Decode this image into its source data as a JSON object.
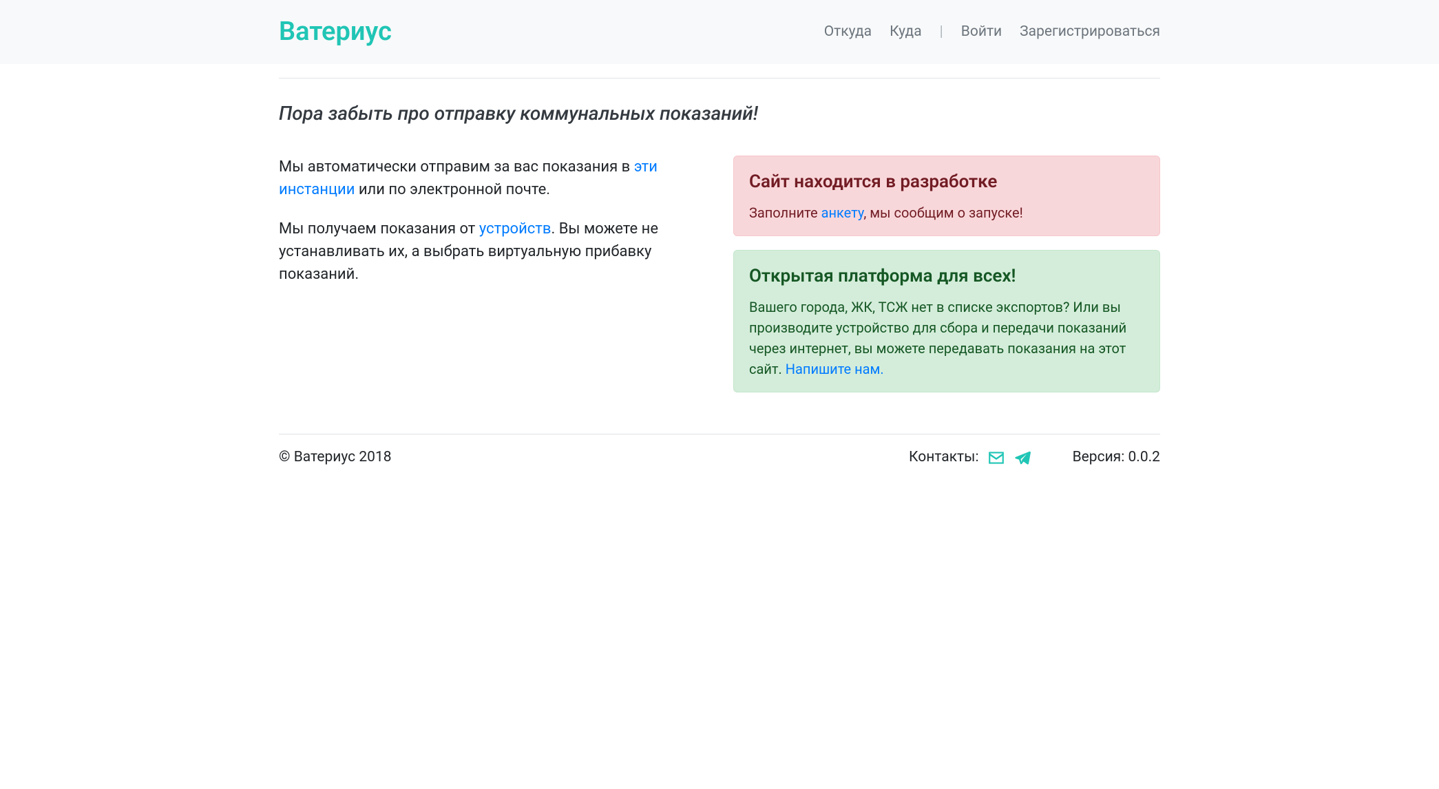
{
  "header": {
    "brand": "Ватериус",
    "nav": {
      "from": "Откуда",
      "to": "Куда",
      "login": "Войти",
      "register": "Зарегистрироваться"
    }
  },
  "main": {
    "slogan": "Пора забыть про отправку коммунальных показаний!",
    "para1_before": "Мы автоматически отправим за вас показания в ",
    "para1_link": "эти инстанции",
    "para1_after": " или по электронной почте.",
    "para2_before": "Мы получаем показания от ",
    "para2_link": "устройств",
    "para2_after": ". Вы можете не устанавливать их, а выбрать виртуальную прибавку показаний.",
    "alert_danger": {
      "heading": "Сайт находится в разработке",
      "text_before": "Заполните ",
      "link": "анкету",
      "text_after": ", мы сообщим о запуске!"
    },
    "alert_success": {
      "heading": "Открытая платформа для всех!",
      "text_before": "Вашего города, ЖК, ТСЖ нет в списке экспортов? Или вы производите устройство для сбора и передачи показаний через интернет, вы можете передавать показания на этот сайт. ",
      "link": "Напишите нам."
    }
  },
  "footer": {
    "copyright": "© Ватериус 2018",
    "contacts_label": "Контакты:",
    "version_label": "Версия: 0.0.2"
  }
}
